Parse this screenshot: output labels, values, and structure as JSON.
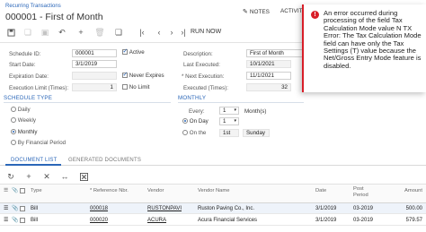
{
  "header": {
    "breadcrumb": "Recurring Transactions",
    "title": "000001 - First of Month",
    "notes": "NOTES",
    "activities": "ACTIVITI"
  },
  "toolbar": {
    "run_now": "RUN NOW"
  },
  "form": {
    "schedule_id_label": "Schedule ID:",
    "schedule_id": "000001",
    "active_label": "Active",
    "start_date_label": "Start Date:",
    "start_date": "3/1/2019",
    "expiration_date_label": "Expiration Date:",
    "never_expires_label": "Never Expires",
    "execution_limit_label": "Execution Limit (Times):",
    "execution_limit": "1",
    "no_limit_label": "No Limit",
    "description_label": "Description:",
    "description": "First of Month",
    "last_executed_label": "Last Executed:",
    "last_executed": "10/1/2021",
    "next_execution_label": "* Next Execution:",
    "next_execution": "11/1/2021",
    "executed_times_label": "Executed (Times):",
    "executed_times": "32"
  },
  "schedule_type": {
    "title": "SCHEDULE TYPE",
    "options": [
      "Daily",
      "Weekly",
      "Monthly",
      "By Financial Period"
    ]
  },
  "monthly": {
    "title": "MONTHLY",
    "every_label": "Every:",
    "every_value": "1",
    "months_label": "Month(s)",
    "on_day_label": "On Day",
    "on_day_value": "1",
    "on_the_label": "On the",
    "on_the_ordinal": "1st",
    "on_the_weekday": "Sunday"
  },
  "tabs": {
    "document_list": "DOCUMENT LIST",
    "generated_documents": "GENERATED DOCUMENTS"
  },
  "grid": {
    "columns": [
      "Type",
      "* Reference Nbr.",
      "Vendor",
      "Vendor Name",
      "Date",
      "Post Period",
      "Amount"
    ],
    "post_label_1": "Post",
    "post_label_2": "Period",
    "rows": [
      {
        "type": "Bill",
        "ref": "000018",
        "vendor": "RUSTONPAVI",
        "vendor_name": "Ruston Paving Co., Inc.",
        "date": "3/1/2019",
        "period": "03-2019",
        "amount": "500.00"
      },
      {
        "type": "Bill",
        "ref": "000020",
        "vendor": "ACURA",
        "vendor_name": "Acura Financial Services",
        "date": "3/1/2019",
        "period": "03-2019",
        "amount": "579.57"
      }
    ]
  },
  "error": {
    "message": "An error occurred during processing of the field Tax Calculation Mode value N TX Error: The Tax Calculation Mode field can have only the Tax Settings (T) value because the Net/Gross Entry Mode feature is disabled."
  },
  "colors": {
    "accent": "#2a66b8",
    "error": "#d81e28"
  }
}
